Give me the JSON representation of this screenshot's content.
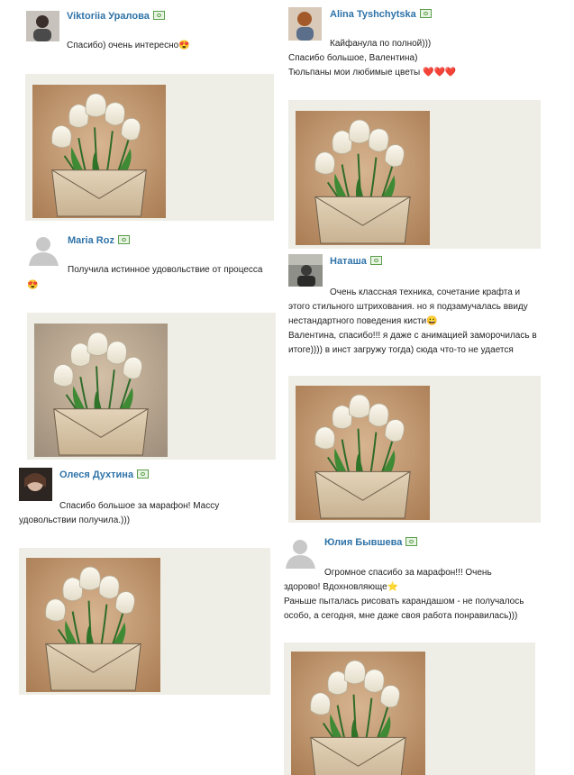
{
  "comments": [
    {
      "author": "Viktoriia Уралова",
      "lines": [
        "Спасибо) очень интересно😍"
      ]
    },
    {
      "author": "Alina Tyshchytska",
      "lines": [
        "Кайфанула по полной)))",
        "Спасибо большое, Валентина)",
        "Тюльпаны мои любимые цветы ❤️❤️❤️"
      ]
    },
    {
      "author": "Maria Roz",
      "lines": [
        "Получила истинное удовольствие от процесса",
        "😍"
      ]
    },
    {
      "author": "Наташа",
      "lines": [
        "Очень классная техника, сочетание крафта и",
        "этого стильного штрихования. но я подзамучалась ввиду",
        "нестандартного поведения кисти😀",
        "Валентина, спасибо!!! я даже с анимацией заморочилась в",
        "итоге)))) в инст загружу тогда) сюда что-то не удается"
      ]
    },
    {
      "author": "Олеся Духтина",
      "lines": [
        "Спасибо большое за марафон! Массу",
        "удовольствии получила.)))"
      ]
    },
    {
      "author": "Юлия Бывшева",
      "lines": [
        "Огромное спасибо за марафон!!! Очень",
        "здорово! Вдохновляюще⭐",
        "Раньше пыталась рисовать карандашом - не получалось",
        "особо, а сегодня, мне даже своя работа понравилась)))"
      ]
    }
  ],
  "colors": {
    "name_link": "#2f73a8",
    "panel_bg": "#efeee6",
    "kraft_dark": "#b98a5e",
    "kraft_light": "#d6b48f"
  }
}
